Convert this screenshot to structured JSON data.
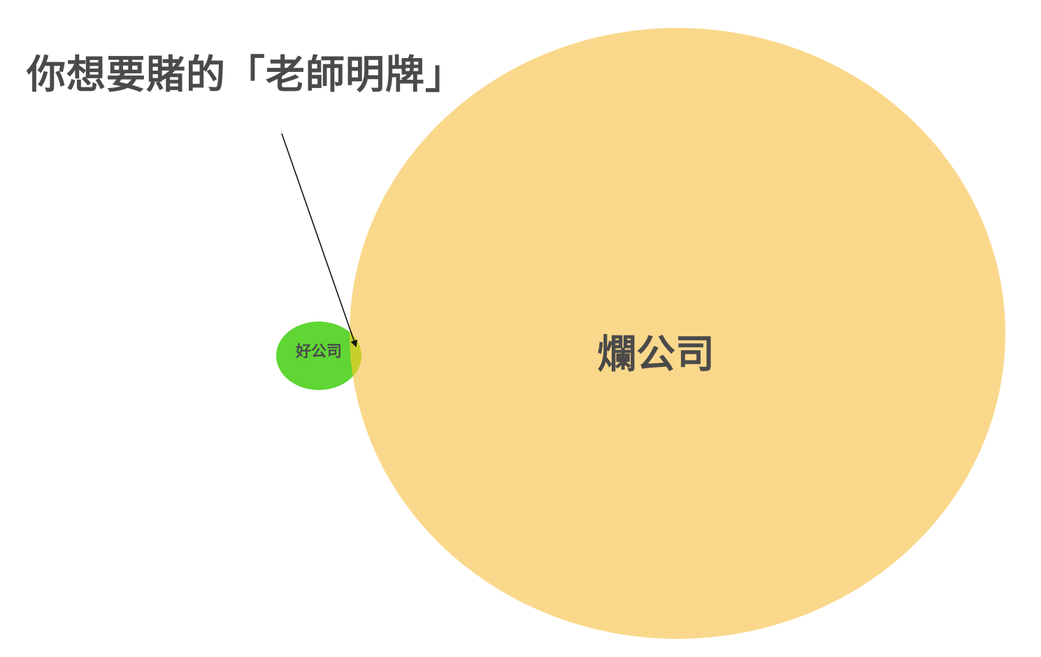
{
  "title": "你想要賭的「老師明牌」",
  "sets": {
    "good": {
      "label": "好公司",
      "color": "#5fd633"
    },
    "bad": {
      "label": "爛公司",
      "color": "#fad88b"
    },
    "overlap": {
      "color": "#c6cf2b"
    }
  },
  "arrow": {
    "color": "#111111"
  }
}
